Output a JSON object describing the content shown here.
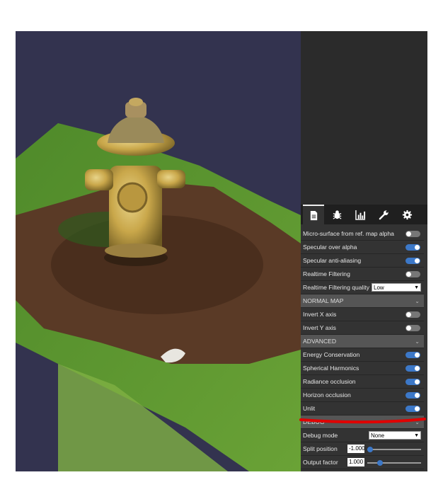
{
  "panel": {
    "tabs": [
      {
        "icon": "document-icon",
        "active": true
      },
      {
        "icon": "bug-icon",
        "active": false
      },
      {
        "icon": "bar-chart-icon",
        "active": false
      },
      {
        "icon": "wrench-icon",
        "active": false
      },
      {
        "icon": "gear-icon",
        "active": false
      }
    ],
    "rows": {
      "micro_surface": {
        "label": "Micro-surface from ref. map alpha",
        "on": false
      },
      "specular_over_alpha": {
        "label": "Specular over alpha",
        "on": true
      },
      "specular_aa": {
        "label": "Specular anti-aliasing",
        "on": true
      },
      "realtime_filtering": {
        "label": "Realtime Filtering",
        "on": false
      },
      "realtime_quality": {
        "label": "Realtime Filtering quality",
        "value": "Low"
      },
      "normal_map_section": {
        "label": "NORMAL MAP"
      },
      "invert_x": {
        "label": "Invert X axis",
        "on": false
      },
      "invert_y": {
        "label": "Invert Y axis",
        "on": false
      },
      "advanced_section": {
        "label": "ADVANCED"
      },
      "energy_conservation": {
        "label": "Energy Conservation",
        "on": true
      },
      "spherical_harmonics": {
        "label": "Spherical Harmonics",
        "on": true
      },
      "radiance_occlusion": {
        "label": "Radiance occlusion",
        "on": true
      },
      "horizon_occlusion": {
        "label": "Horizon occlusion",
        "on": true
      },
      "unlit": {
        "label": "Unlit",
        "on": true
      },
      "debug_section": {
        "label": "DEBUG"
      },
      "debug_mode": {
        "label": "Debug mode",
        "value": "None"
      },
      "split_position": {
        "label": "Split position",
        "value": "-1.000",
        "fraction": 0.0
      },
      "output_factor": {
        "label": "Output factor",
        "value": "1.000",
        "fraction": 0.2
      }
    }
  },
  "colors": {
    "viewport_bg": "#33334f",
    "panel_bg": "#333333",
    "accent": "#3c78c8",
    "annotation": "#e00000"
  }
}
